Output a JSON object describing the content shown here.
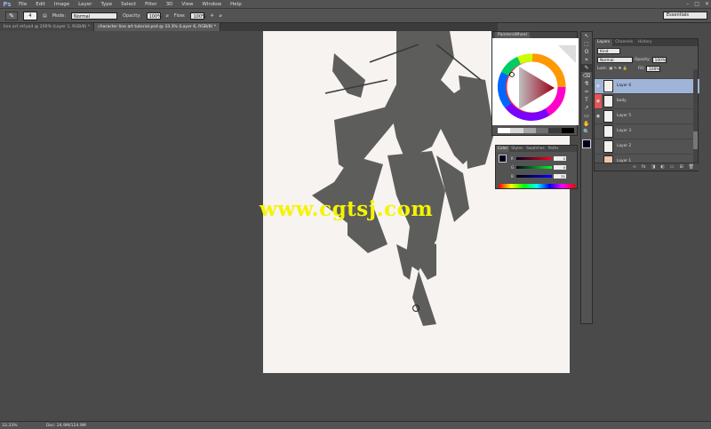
{
  "app": {
    "logo": "Ps"
  },
  "menu": [
    "File",
    "Edit",
    "Image",
    "Layer",
    "Type",
    "Select",
    "Filter",
    "3D",
    "View",
    "Window",
    "Help"
  ],
  "window_controls": [
    "–",
    "□",
    "✕"
  ],
  "options": {
    "brush_size": "4",
    "mode_label": "Mode:",
    "mode_value": "Normal",
    "opacity_label": "Opacity:",
    "opacity_value": "100%",
    "flow_label": "Flow:",
    "flow_value": "100%",
    "workspace": "Essentials"
  },
  "tabs": [
    "line art ref.psd @ 200% (Layer 1, RGB/8) *",
    "character line art tutorial.psd @ 33.3% (Layer 6, RGB/8) *"
  ],
  "watermark": "www.cgtsj.com",
  "paintwheel": {
    "title": "PaintersWheel",
    "swatches": [
      "#ffffff",
      "#d8d8d8",
      "#a8a8a8",
      "#6e6e6e",
      "#3a3a3a",
      "#000000"
    ]
  },
  "color_panel": {
    "tabs": [
      "Color",
      "Styles",
      "Swatches",
      "Paths"
    ],
    "channels": [
      {
        "ch": "R",
        "value": "0"
      },
      {
        "ch": "G",
        "value": "0"
      },
      {
        "ch": "B",
        "value": "31"
      }
    ]
  },
  "tools": [
    "↖",
    "⬚",
    "ʘ",
    "⌖",
    "✎",
    "⌫",
    "⚗",
    "✑",
    "T",
    "↗",
    "▭",
    "✋",
    "🔍"
  ],
  "layers_panel": {
    "tabs": [
      "Layers",
      "Channels",
      "History"
    ],
    "kind_label": "Kind",
    "blend_mode": "Normal",
    "opacity_label": "Opacity:",
    "opacity_value": "100%",
    "lock_label": "Lock:",
    "fill_label": "Fill:",
    "fill_value": "100%",
    "layers": [
      "Layer 6",
      "body",
      "Layer 5",
      "Layer 3",
      "Layer 2",
      "Layer 1"
    ],
    "footer_icons": [
      "∞",
      "fx",
      "◨",
      "◐",
      "▭",
      "⊞",
      "🗑"
    ]
  },
  "status": {
    "zoom": "33.33%",
    "doc": "Doc: 24.9M/124.9M"
  }
}
